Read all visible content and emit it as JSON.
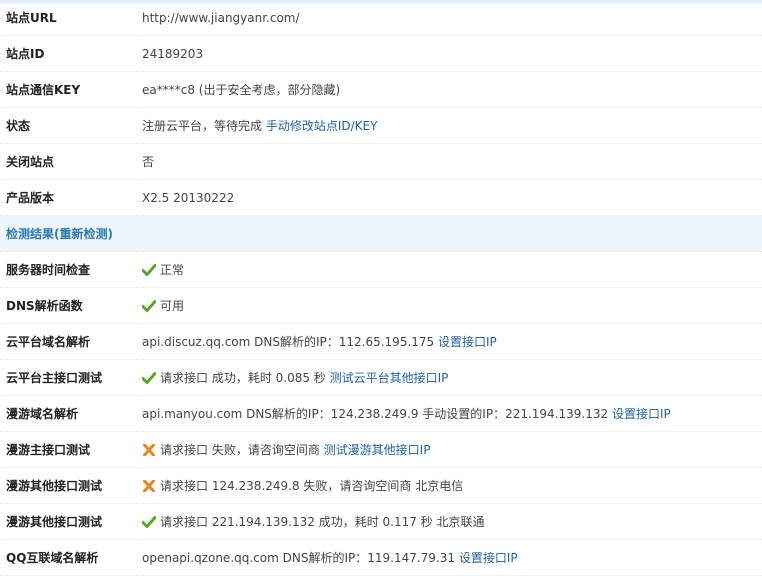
{
  "rows": {
    "site_url": {
      "label": "站点URL",
      "value": "http://www.jiangyanr.com/"
    },
    "site_id": {
      "label": "站点ID",
      "value": "24189203"
    },
    "site_key": {
      "label": "站点通信KEY",
      "value": "ea****c8 (出于安全考虑，部分隐藏)"
    },
    "status": {
      "label": "状态",
      "value": "注册云平台，等待完成",
      "link": "手动修改站点ID/KEY"
    },
    "closed": {
      "label": "关闭站点",
      "value": "否"
    },
    "version": {
      "label": "产品版本",
      "value": "X2.5 20130222"
    }
  },
  "section": {
    "title": "检测结果(",
    "link": "重新检测",
    "suffix": ")"
  },
  "checks": {
    "server_time": {
      "label": "服务器时间检查",
      "value": "正常",
      "status": "ok"
    },
    "dns_function": {
      "label": "DNS解析函数",
      "value": "可用",
      "status": "ok"
    },
    "cloud_dns": {
      "label": "云平台域名解析",
      "value": "api.discuz.qq.com DNS解析的IP：112.65.195.175",
      "link": "设置接口IP"
    },
    "cloud_main": {
      "label": "云平台主接口测试",
      "value": "请求接口 成功，耗时 0.085 秒",
      "link": "测试云平台其他接口IP",
      "status": "ok"
    },
    "manyou_dns": {
      "label": "漫游域名解析",
      "value": "api.manyou.com DNS解析的IP：124.238.249.9 手动设置的IP：221.194.139.132",
      "link": "设置接口IP"
    },
    "manyou_main": {
      "label": "漫游主接口测试",
      "value": "请求接口 失败，请咨询空间商",
      "link": "测试漫游其他接口IP",
      "status": "fail"
    },
    "manyou_other_1": {
      "label": "漫游其他接口测试",
      "value": "请求接口 124.238.249.8 失败，请咨询空间商 北京电信",
      "status": "fail"
    },
    "manyou_other_2": {
      "label": "漫游其他接口测试",
      "value": "请求接口 221.194.139.132 成功，耗时 0.117 秒 北京联通",
      "status": "ok"
    },
    "qq_dns": {
      "label": "QQ互联域名解析",
      "value": "openapi.qzone.qq.com DNS解析的IP：119.147.79.31",
      "link": "设置接口IP"
    }
  },
  "colors": {
    "ok_icon": "#5aa52a",
    "fail_icon": "#f0821e",
    "link": "#1f62a6",
    "section_bg": "#eef5fb"
  }
}
